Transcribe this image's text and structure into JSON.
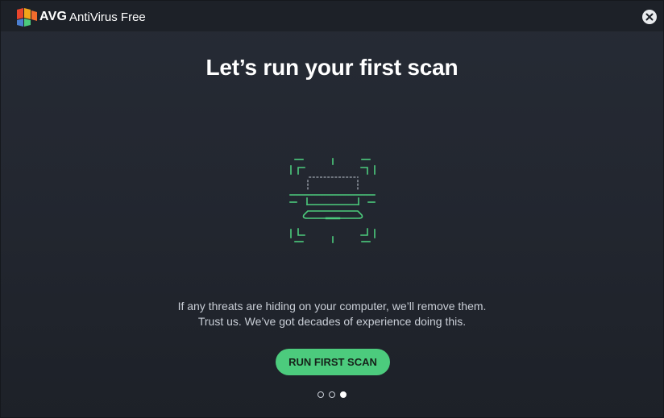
{
  "window": {
    "brand": "AVG",
    "product": "AntiVirus Free"
  },
  "main": {
    "heading": "Let’s run your first scan",
    "description_line1": "If any threats are hiding on your computer, we’ll remove them.",
    "description_line2": "Trust us. We’ve got decades of experience doing this.",
    "cta_label": "RUN FIRST SCAN"
  },
  "pager": {
    "total": 3,
    "current": 3
  },
  "icons": {
    "logo": "avg-logo-icon",
    "close": "close-icon",
    "illustration": "laptop-scan-icon"
  },
  "colors": {
    "accent": "#4ccb7d",
    "background": "#22262f",
    "titlebar": "#1d2128"
  }
}
